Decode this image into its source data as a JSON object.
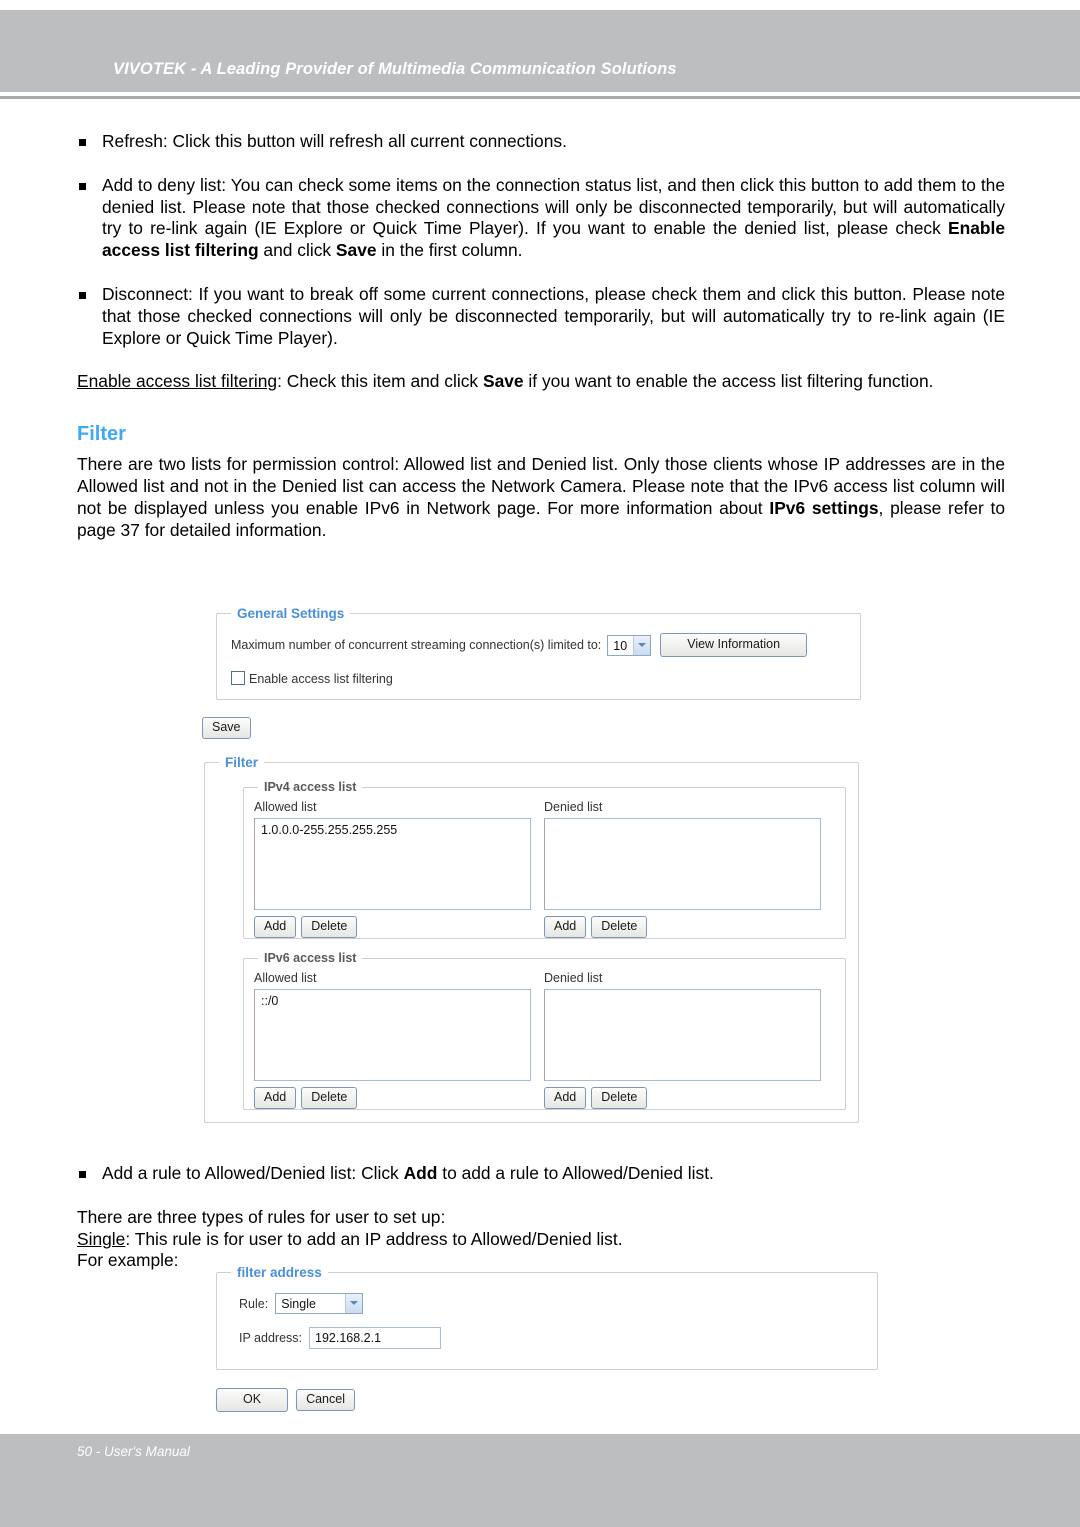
{
  "header": {
    "title": "VIVOTEK - A Leading Provider of Multimedia Communication Solutions"
  },
  "footer": {
    "text": "50 - User's Manual"
  },
  "body": {
    "bullet_refresh": "Refresh: Click this button will refresh all current connections.",
    "bullet_add_deny_1": "Add to deny list: You can check some items on the connection status list, and then click this button to add them to the denied list. Please note that those checked connections will only be disconnected temporarily, but will automatically try to re-link again (IE Explore or Quick Time Player). If you want to enable the denied list, please check ",
    "bullet_add_deny_bold1": "Enable access list filtering",
    "bullet_add_deny_mid": " and click ",
    "bullet_add_deny_bold2": "Save",
    "bullet_add_deny_end": " in the first column.",
    "bullet_disconnect": "Disconnect: If you want to break off some current connections, please check them and click this button. Please note that those checked connections will only be disconnected temporarily, but will automatically try to re-link again (IE Explore or Quick Time Player).",
    "enable_filtering_underline": "Enable access list filtering",
    "enable_filtering_1": ": Check this item and click ",
    "enable_filtering_bold": "Save",
    "enable_filtering_2": " if you want to enable the access list filtering function.",
    "filter_heading": "Filter",
    "filter_para_1": "There are two lists for permission control: Allowed list and Denied list. Only those clients whose IP addresses are in the Allowed list and not in the Denied list can access the Network Camera. Please note that the IPv6 access list column will not be displayed unless you enable IPv6 in Network page. For more information about ",
    "filter_para_bold": "IPv6 settings",
    "filter_para_2": ", please refer to page 37 for detailed information.",
    "bullet_add_rule_1": "Add a rule to Allowed/Denied list: Click ",
    "bullet_add_rule_bold": "Add",
    "bullet_add_rule_2": " to add a rule to Allowed/Denied list.",
    "three_types": "There are three types of rules for user to set up:",
    "single_underline": "Single",
    "single_rest": ": This rule is for user to add an IP address to Allowed/Denied list.",
    "for_example": "For example:"
  },
  "general_settings": {
    "legend": "General Settings",
    "max_conn_label": "Maximum number of concurrent streaming connection(s) limited to:",
    "max_conn_value": "10",
    "view_information_button": "View Information",
    "enable_filtering_checkbox_label": "Enable access list filtering",
    "enable_filtering_checked": false,
    "save_button": "Save"
  },
  "filter_panel": {
    "legend": "Filter",
    "ipv4": {
      "legend": "IPv4 access list",
      "allowed_label": "Allowed list",
      "allowed_items": "1.0.0.0-255.255.255.255",
      "denied_label": "Denied list",
      "denied_items": "",
      "add_button": "Add",
      "delete_button": "Delete"
    },
    "ipv6": {
      "legend": "IPv6 access list",
      "allowed_label": "Allowed list",
      "allowed_items": "::/0",
      "denied_label": "Denied list",
      "denied_items": "",
      "add_button": "Add",
      "delete_button": "Delete"
    }
  },
  "filter_address": {
    "legend": "filter address",
    "rule_label": "Rule:",
    "rule_value": "Single",
    "ip_label": "IP address:",
    "ip_value": "192.168.2.1",
    "ok_button": "OK",
    "cancel_button": "Cancel"
  },
  "colors": {
    "header_band": "#bcbec0",
    "heading_blue": "#3fa9f5",
    "legend_blue": "#4a90d9",
    "page_bg": "#ffffff"
  }
}
